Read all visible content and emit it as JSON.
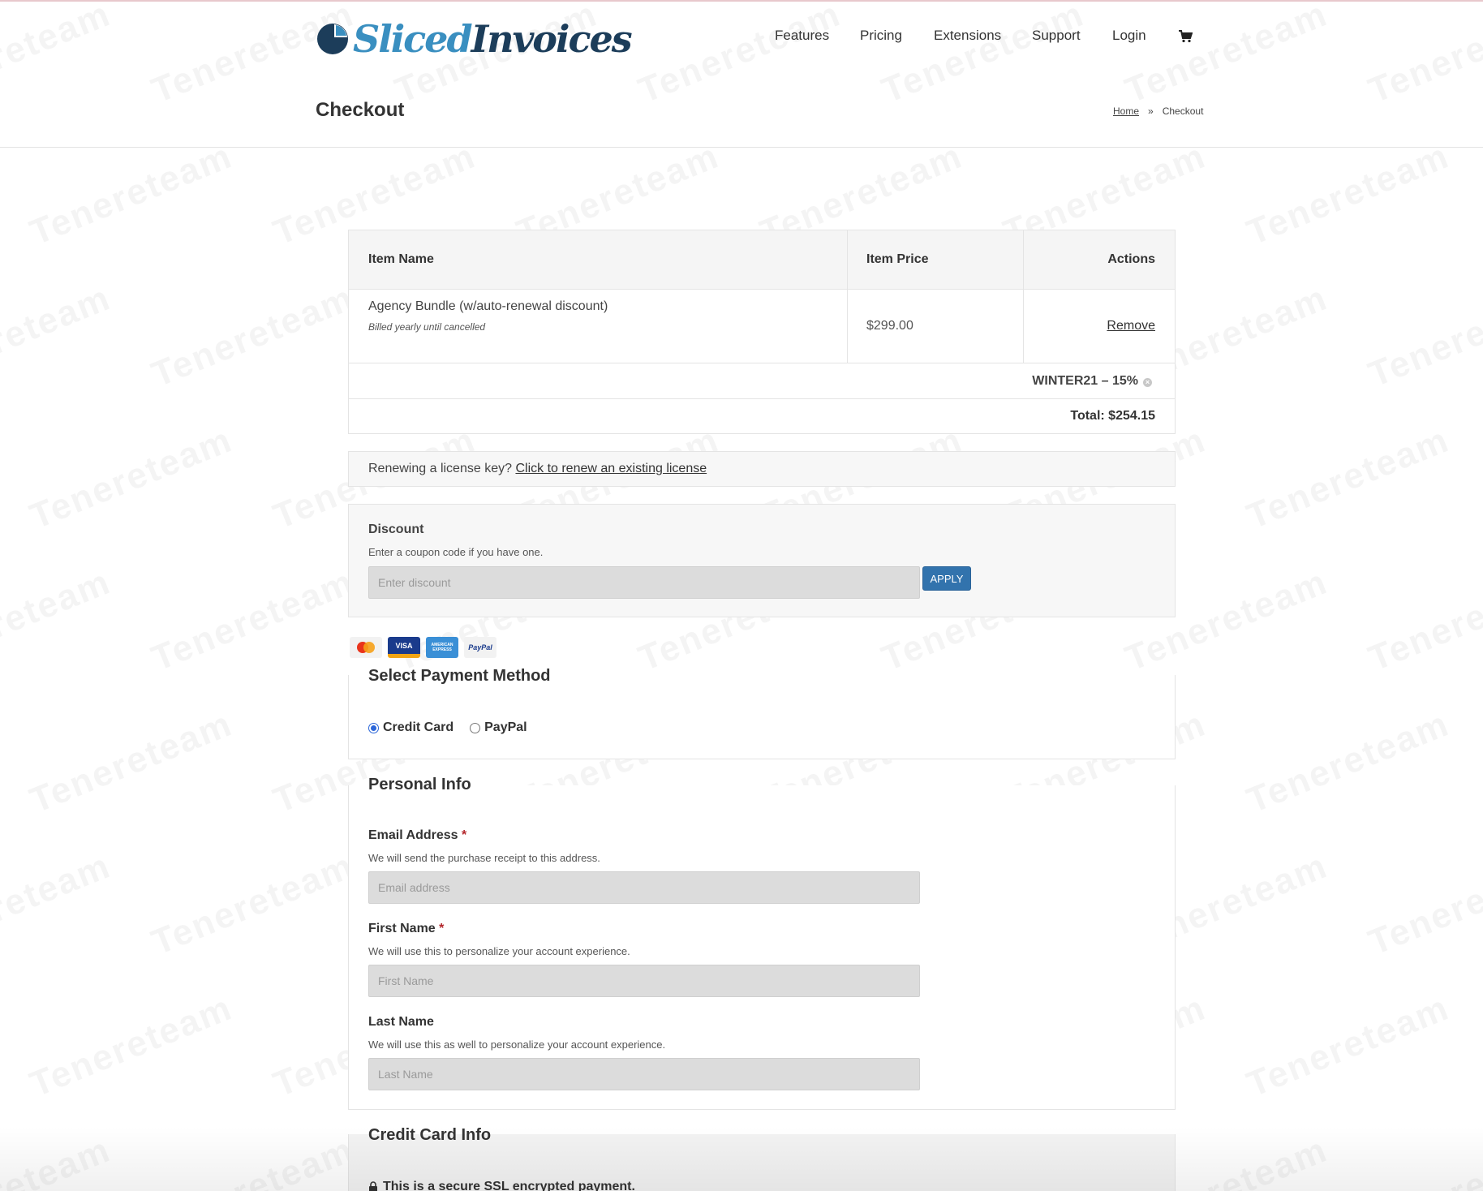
{
  "brand": {
    "logo_part1": "Sliced",
    "logo_part2": "Invoices"
  },
  "nav": {
    "items": [
      "Features",
      "Pricing",
      "Extensions",
      "Support",
      "Login"
    ]
  },
  "page": {
    "title": "Checkout"
  },
  "breadcrumb": {
    "home": "Home",
    "separator": "»",
    "current": "Checkout"
  },
  "cart": {
    "headers": {
      "name": "Item Name",
      "price": "Item Price",
      "actions": "Actions"
    },
    "item": {
      "name": "Agency Bundle (w/auto-renewal discount)",
      "billing": "Billed yearly until cancelled",
      "price": "$299.00",
      "remove": "Remove"
    },
    "discount_applied": "WINTER21 – 15%",
    "remove_discount_icon": "×",
    "total": "Total: $254.15"
  },
  "renew": {
    "prompt": "Renewing a license key?",
    "link": "Click to renew an existing license"
  },
  "discount": {
    "title": "Discount",
    "help": "Enter a coupon code if you have one.",
    "placeholder": "Enter discount",
    "apply": "APPLY"
  },
  "payment": {
    "cards": [
      {
        "icon": "mastercard-icon",
        "color": "#f2f2f2"
      },
      {
        "icon": "visa-icon",
        "label": "VISA",
        "color": "#1a3b8c"
      },
      {
        "icon": "amex-icon",
        "label": "AMERICAN EXPRESS",
        "color": "#3a8fd6"
      },
      {
        "icon": "paypal-icon",
        "label": "PayPal",
        "color": "#f2f2f2"
      }
    ],
    "title": "Select Payment Method",
    "options": [
      {
        "label": "Credit Card",
        "selected": true
      },
      {
        "label": "PayPal",
        "selected": false
      }
    ]
  },
  "personal": {
    "title": "Personal Info",
    "email": {
      "label": "Email Address",
      "required": "*",
      "help": "We will send the purchase receipt to this address.",
      "placeholder": "Email address"
    },
    "first": {
      "label": "First Name",
      "required": "*",
      "help": "We will use this to personalize your account experience.",
      "placeholder": "First Name"
    },
    "last": {
      "label": "Last Name",
      "help": "We will use this as well to personalize your account experience.",
      "placeholder": "Last Name"
    }
  },
  "credit": {
    "title": "Credit Card Info",
    "secure_note": "This is a secure SSL encrypted payment."
  },
  "watermark": {
    "text": "Tenereteam"
  },
  "colors": {
    "accent": "#3273ad",
    "required": "#b3262b",
    "radio": "#2b66d9"
  }
}
